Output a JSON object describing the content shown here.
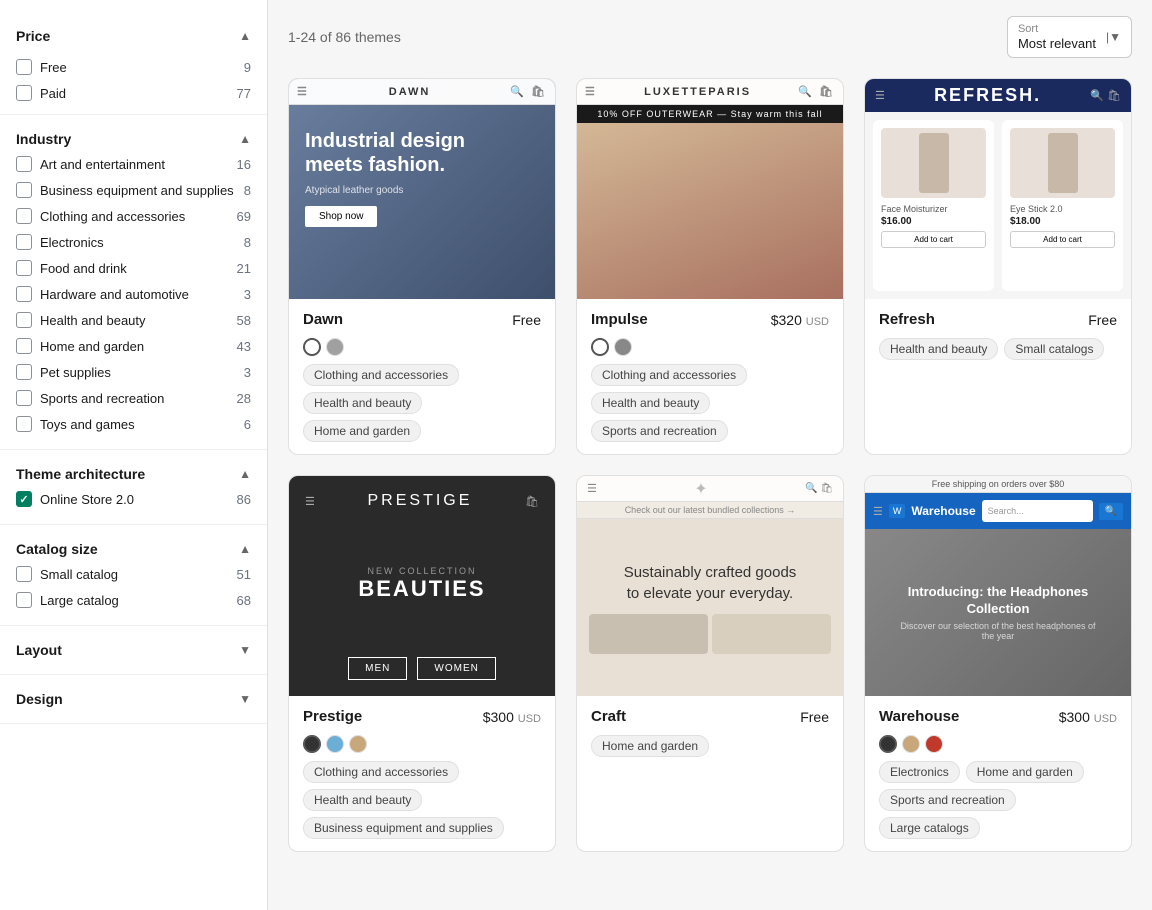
{
  "sidebar": {
    "price_title": "Price",
    "industry_title": "Industry",
    "theme_arch_title": "Theme architecture",
    "catalog_size_title": "Catalog size",
    "layout_title": "Layout",
    "design_title": "Design",
    "price_filters": [
      {
        "label": "Free",
        "count": 9,
        "checked": false
      },
      {
        "label": "Paid",
        "count": 77,
        "checked": false
      }
    ],
    "industry_filters": [
      {
        "label": "Art and entertainment",
        "count": 16,
        "checked": false
      },
      {
        "label": "Business equipment and supplies",
        "count": 8,
        "checked": false
      },
      {
        "label": "Clothing and accessories",
        "count": 69,
        "checked": false
      },
      {
        "label": "Electronics",
        "count": 8,
        "checked": false
      },
      {
        "label": "Food and drink",
        "count": 21,
        "checked": false
      },
      {
        "label": "Hardware and automotive",
        "count": 3,
        "checked": false
      },
      {
        "label": "Health and beauty",
        "count": 58,
        "checked": false
      },
      {
        "label": "Home and garden",
        "count": 43,
        "checked": false
      },
      {
        "label": "Pet supplies",
        "count": 3,
        "checked": false
      },
      {
        "label": "Sports and recreation",
        "count": 28,
        "checked": false
      },
      {
        "label": "Toys and games",
        "count": 6,
        "checked": false
      }
    ],
    "theme_arch_filters": [
      {
        "label": "Online Store 2.0",
        "count": 86,
        "checked": true
      }
    ],
    "catalog_filters": [
      {
        "label": "Small catalog",
        "count": 51,
        "checked": false
      },
      {
        "label": "Large catalog",
        "count": 68,
        "checked": false
      }
    ]
  },
  "main": {
    "results_count": "1-24 of 86 themes",
    "sort_label": "Sort",
    "sort_value": "Most relevant",
    "themes": [
      {
        "name": "Dawn",
        "price": "Free",
        "price_usd": "",
        "tags": [
          "Clothing and accessories",
          "Health and beauty",
          "Home and garden"
        ],
        "colors": [
          "#ffffff",
          "#a0a0a0"
        ],
        "preview_type": "dawn"
      },
      {
        "name": "Impulse",
        "price": "$320",
        "price_usd": "USD",
        "tags": [
          "Clothing and accessories",
          "Health and beauty",
          "Sports and recreation"
        ],
        "colors": [
          "#ffffff",
          "#888888"
        ],
        "preview_type": "impulse"
      },
      {
        "name": "Refresh",
        "price": "Free",
        "price_usd": "",
        "tags": [
          "Health and beauty",
          "Small catalogs"
        ],
        "colors": [],
        "preview_type": "refresh"
      },
      {
        "name": "Prestige",
        "price": "$300",
        "price_usd": "USD",
        "tags": [
          "Clothing and accessories",
          "Health and beauty",
          "Business equipment and supplies"
        ],
        "colors": [
          "#333333",
          "#6baed6",
          "#c8a87a"
        ],
        "preview_type": "prestige"
      },
      {
        "name": "Craft",
        "price": "Free",
        "price_usd": "",
        "tags": [
          "Home and garden"
        ],
        "colors": [],
        "preview_type": "craft"
      },
      {
        "name": "Warehouse",
        "price": "$300",
        "price_usd": "USD",
        "tags": [
          "Electronics",
          "Home and garden",
          "Sports and recreation",
          "Large catalogs"
        ],
        "colors": [
          "#333333",
          "#c8a87a",
          "#c0392b"
        ],
        "preview_type": "warehouse"
      }
    ]
  }
}
